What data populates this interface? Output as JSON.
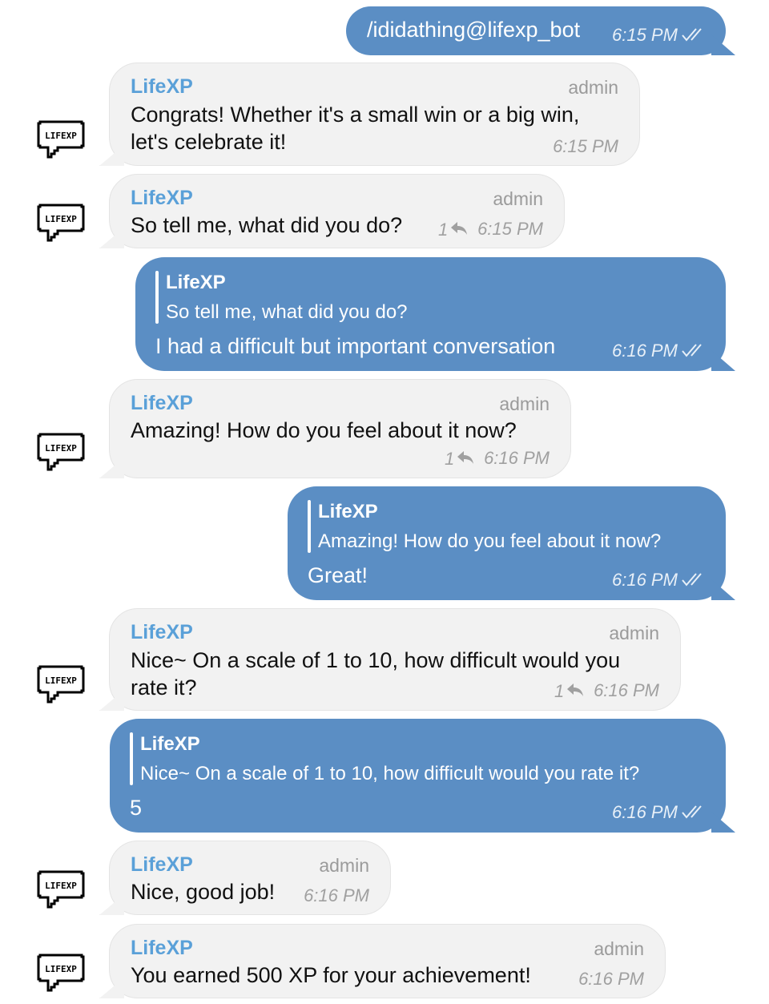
{
  "messages": [
    {
      "text": "/ididathing@lifexp_bot",
      "time": "6:15 PM"
    },
    {
      "sender": "LifeXP",
      "role": "admin",
      "line1": "Congrats! Whether it's a small win or a big win,",
      "line2": "let's celebrate it!",
      "time": "6:15 PM"
    },
    {
      "sender": "LifeXP",
      "role": "admin",
      "text": "So tell me, what did you do?",
      "replies": "1",
      "time": "6:15 PM"
    },
    {
      "quote_name": "LifeXP",
      "quote_text": "So tell me, what did you do?",
      "text": "I had a difficult but important conversation",
      "time": "6:16 PM"
    },
    {
      "sender": "LifeXP",
      "role": "admin",
      "text": "Amazing! How do you feel about it now?",
      "replies": "1",
      "time": "6:16 PM"
    },
    {
      "quote_name": "LifeXP",
      "quote_text": "Amazing! How do you feel about it now?",
      "text": "Great!",
      "time": "6:16 PM"
    },
    {
      "sender": "LifeXP",
      "role": "admin",
      "line1": "Nice~ On a scale of 1 to 10, how difficult would you",
      "line2": "rate it?",
      "replies": "1",
      "time": "6:16 PM"
    },
    {
      "quote_name": "LifeXP",
      "quote_text": "Nice~ On a scale of 1 to 10, how difficult would you rate it?",
      "text": "5",
      "time": "6:16 PM"
    },
    {
      "sender": "LifeXP",
      "role": "admin",
      "text": "Nice, good job!",
      "time": "6:16 PM"
    },
    {
      "sender": "LifeXP",
      "role": "admin",
      "text": "You earned 500 XP for your achievement!",
      "time": "6:16 PM"
    }
  ],
  "avatar": {
    "label": "LIFEXP",
    "icon": "speech-bubble-logo"
  },
  "colors": {
    "outgoing": "#5b8ec4",
    "incoming": "#f2f2f2",
    "sender": "#5aa0d8"
  }
}
